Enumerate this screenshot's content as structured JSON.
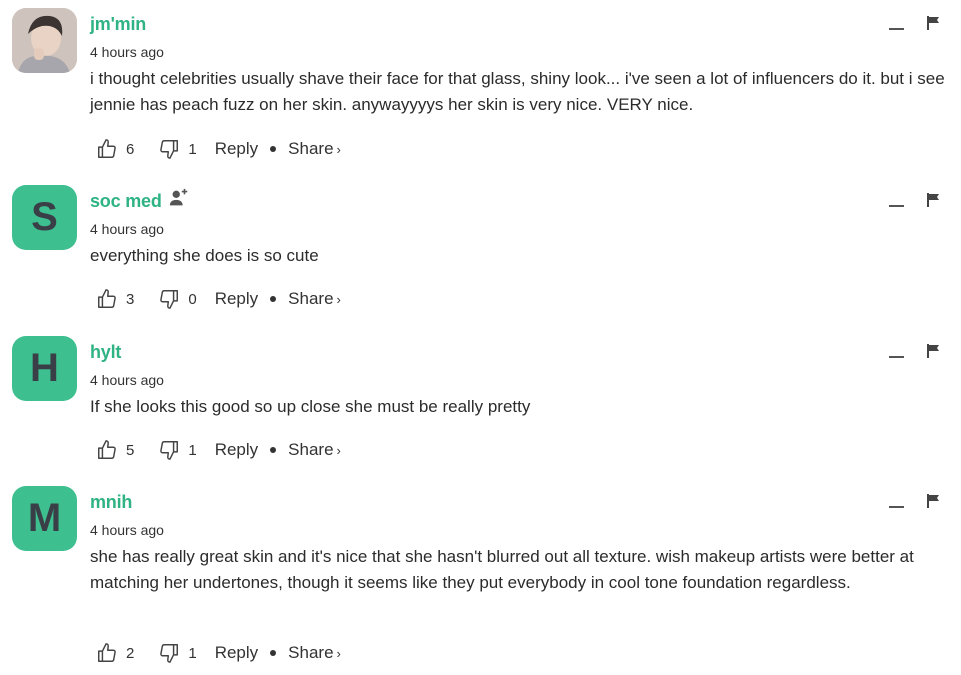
{
  "comments": [
    {
      "username": "jm'min",
      "avatar_letter": "",
      "avatar_type": "photo",
      "time": "4 hours ago",
      "text": "i thought celebrities usually shave their face for that glass, shiny look... i've seen a lot of influencers do it. but i see jennie has peach fuzz on her skin. anywayyyys her skin is very nice. VERY nice.",
      "likes": "6",
      "dislikes": "1",
      "reply_label": "Reply",
      "share_label": "Share",
      "share_chevron": "›"
    },
    {
      "username": "soc med",
      "avatar_letter": "S",
      "avatar_type": "letter",
      "time": "4 hours ago",
      "text": "everything she does is so cute",
      "likes": "3",
      "dislikes": "0",
      "reply_label": "Reply",
      "share_label": "Share",
      "share_chevron": "›"
    },
    {
      "username": "hylt",
      "avatar_letter": "H",
      "avatar_type": "letter",
      "time": "4 hours ago",
      "text": "If she looks this good so up close she must be really pretty",
      "likes": "5",
      "dislikes": "1",
      "reply_label": "Reply",
      "share_label": "Share",
      "share_chevron": "›"
    },
    {
      "username": "mnih",
      "avatar_letter": "M",
      "avatar_type": "letter",
      "time": "4 hours ago",
      "text": "she has really great skin and it's nice that she hasn't blurred out all texture. wish makeup artists were better at matching her undertones, though it seems like they put everybody in cool tone foundation regardless.",
      "likes": "2",
      "dislikes": "1",
      "reply_label": "Reply",
      "share_label": "Share",
      "share_chevron": "›"
    }
  ],
  "colors": {
    "accent": "#2fb384",
    "avatar_bg": "#3dbf8f",
    "avatar_text": "#3a3f47"
  },
  "icons": [
    "thumbs-up-icon",
    "thumbs-down-icon",
    "collapse-icon",
    "flag-icon",
    "follow-user-icon"
  ]
}
